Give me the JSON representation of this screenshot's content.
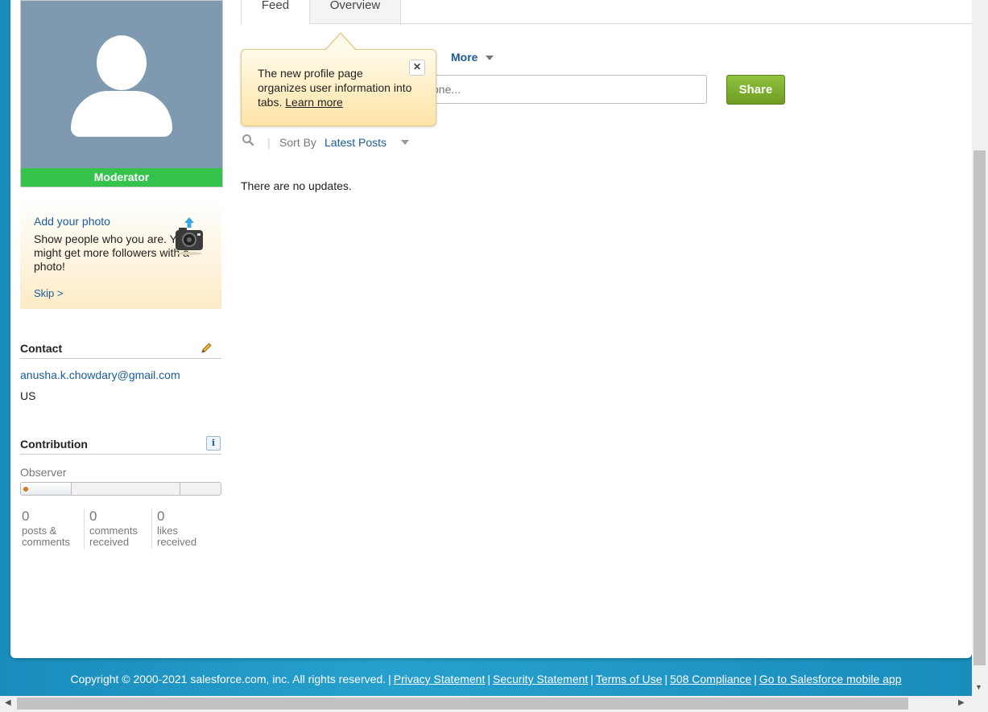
{
  "sidebar": {
    "avatar_badge": "Moderator",
    "photo_card": {
      "title": "Add your photo",
      "description": "Show people who you are. You might get more followers with a photo!",
      "skip": "Skip >"
    },
    "contact": {
      "title": "Contact",
      "email": "anusha.k.chowdary@gmail.com",
      "country": "US"
    },
    "contribution": {
      "title": "Contribution",
      "level": "Observer",
      "progress_fraction": 0.25,
      "stats": [
        {
          "value": "0",
          "label": "posts & comments"
        },
        {
          "value": "0",
          "label": "comments received"
        },
        {
          "value": "0",
          "label": "likes received"
        }
      ]
    }
  },
  "tabs": [
    {
      "label": "Feed",
      "active": true
    },
    {
      "label": "Overview",
      "active": false
    }
  ],
  "publisher": {
    "more_label": "More",
    "input_placeholder": "one...",
    "share_label": "Share"
  },
  "sort": {
    "label": "Sort By",
    "value": "Latest Posts"
  },
  "feed": {
    "empty_message": "There are no updates."
  },
  "tooltip": {
    "text": "The new profile page organizes user information into tabs.",
    "link": "Learn more",
    "close": "✕"
  },
  "footer": {
    "copyright": "Copyright © 2000-2021 salesforce.com, inc. All rights reserved.",
    "links": [
      "Privacy Statement",
      "Security Statement",
      "Terms of Use",
      "508 Compliance",
      "Go to Salesforce mobile app"
    ]
  },
  "colors": {
    "accent_blue": "#1a5b9a",
    "badge_green": "#35c24d",
    "share_green": "#7fb030",
    "background_blue": "#1e95c4"
  }
}
